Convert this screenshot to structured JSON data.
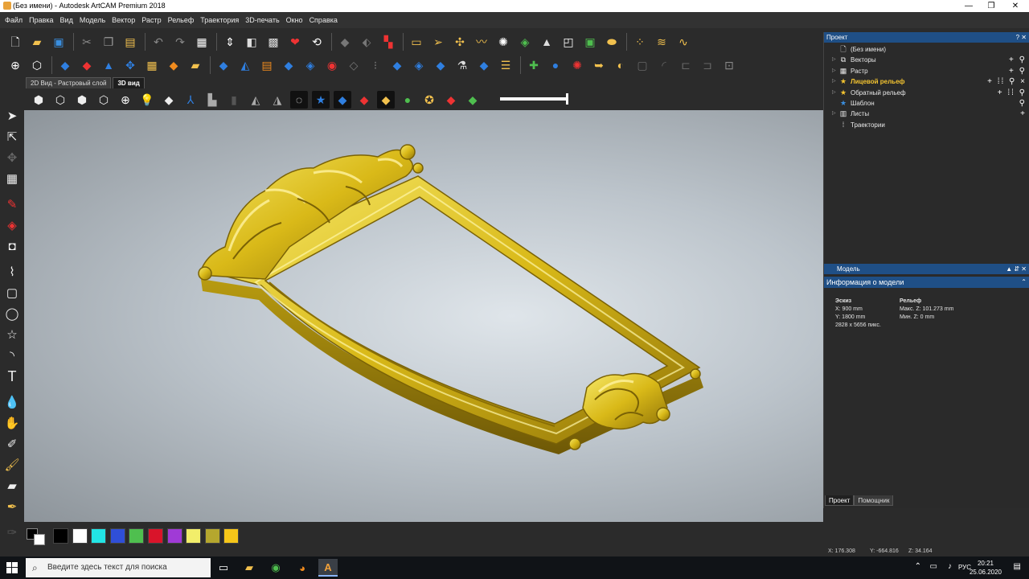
{
  "window": {
    "title": "(Без имени) - Autodesk ArtCAM Premium 2018",
    "controls": [
      "minimize-icon",
      "restore-icon",
      "close-icon"
    ]
  },
  "menu": [
    "Файл",
    "Правка",
    "Вид",
    "Модель",
    "Вектор",
    "Растр",
    "Рельеф",
    "Траектория",
    "3D-печать",
    "Окно",
    "Справка"
  ],
  "view_tabs": [
    {
      "label": "2D Вид - Растровый слой",
      "active": false
    },
    {
      "label": "3D вид",
      "active": true
    }
  ],
  "project_panel": {
    "title": "Проект",
    "controls": "? ✕",
    "items": [
      {
        "label": "(Без имени)",
        "icon": "document-icon",
        "highlight": false,
        "expand": false
      },
      {
        "label": "Векторы",
        "icon": "vector-layers-icon",
        "highlight": false,
        "expand": true
      },
      {
        "label": "Растр",
        "icon": "raster-icon",
        "highlight": false,
        "expand": true
      },
      {
        "label": "Лицевой рельеф",
        "icon": "star-relief-icon",
        "highlight": true,
        "expand": true
      },
      {
        "label": "Обратный рельеф",
        "icon": "star-relief-icon",
        "highlight": false,
        "expand": true
      },
      {
        "label": "Шаблон",
        "icon": "star-template-icon",
        "highlight": false,
        "expand": false
      },
      {
        "label": "Листы",
        "icon": "sheets-icon",
        "highlight": false,
        "expand": true
      },
      {
        "label": "Траектории",
        "icon": "toolpaths-icon",
        "highlight": false,
        "expand": false
      }
    ]
  },
  "model_panel": {
    "title": "Модель",
    "info_title": "Информация о модели",
    "sketch": {
      "heading": "Эскиз",
      "x": "X: 900 mm",
      "y": "Y: 1800 mm",
      "pixels": "2828 x 5656 пикс."
    },
    "relief": {
      "heading": "Рельеф",
      "max_z": "Макс. Z: 101.273 mm",
      "min_z": "Мин. Z: 0 mm"
    }
  },
  "panel_tabs": [
    {
      "label": "Проект",
      "active": true
    },
    {
      "label": "Помощник",
      "active": false
    }
  ],
  "palette": {
    "colors": [
      "#000000",
      "#ffffff",
      "#22e5e5",
      "#2f4fd8",
      "#4fbf4f",
      "#d9142a",
      "#a03ad6",
      "#f2ee6a",
      "#b5a72e",
      "#f6c619"
    ]
  },
  "status": {
    "x": "X: 176.308",
    "y": "Y: -664.816",
    "z": "Z: 34.164"
  },
  "taskbar": {
    "search_placeholder": "Введите здесь текст для поиска",
    "apps": [
      "task-view-icon",
      "file-explorer-icon",
      "chrome-icon",
      "firefox-icon",
      "artcam-icon"
    ],
    "language": "РУС",
    "time": "20:21",
    "date": "25.06.2020"
  },
  "colors": {
    "accent_header": "#1f4f86",
    "relief_gold": "#e8c520",
    "background": "#2b2b2b"
  }
}
